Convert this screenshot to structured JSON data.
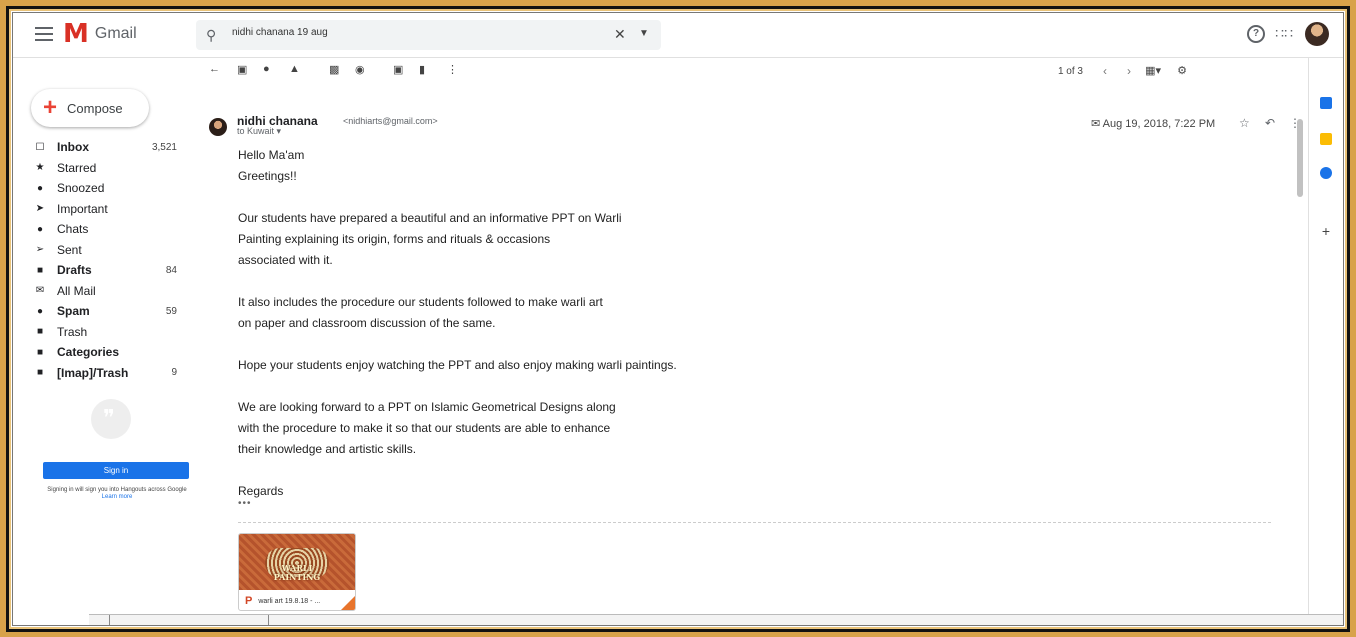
{
  "app": {
    "name": "Gmail"
  },
  "search": {
    "value": "nidhi chanana 19 aug"
  },
  "compose": {
    "label": "Compose"
  },
  "nav": [
    {
      "label": "Inbox",
      "count": "3,521",
      "icon": "inbox-icon",
      "glyph": "☐",
      "bold": true
    },
    {
      "label": "Starred",
      "count": "",
      "icon": "star-icon",
      "glyph": "★",
      "bold": false
    },
    {
      "label": "Snoozed",
      "count": "",
      "icon": "clock-icon",
      "glyph": "●",
      "bold": false
    },
    {
      "label": "Important",
      "count": "",
      "icon": "important-icon",
      "glyph": "➤",
      "bold": false
    },
    {
      "label": "Chats",
      "count": "",
      "icon": "chat-icon",
      "glyph": "●",
      "bold": false
    },
    {
      "label": "Sent",
      "count": "",
      "icon": "send-icon",
      "glyph": "➢",
      "bold": false
    },
    {
      "label": "Drafts",
      "count": "84",
      "icon": "draft-icon",
      "glyph": "■",
      "bold": true
    },
    {
      "label": "All Mail",
      "count": "",
      "icon": "all-mail-icon",
      "glyph": "✉",
      "bold": false
    },
    {
      "label": "Spam",
      "count": "59",
      "icon": "spam-icon",
      "glyph": "●",
      "bold": true
    },
    {
      "label": "Trash",
      "count": "",
      "icon": "trash-icon",
      "glyph": "■",
      "bold": false
    },
    {
      "label": "Categories",
      "count": "",
      "icon": "label-icon",
      "glyph": "■",
      "bold": true
    },
    {
      "label": "[Imap]/Trash",
      "count": "9",
      "icon": "label-icon",
      "glyph": "■",
      "bold": true
    }
  ],
  "hangouts": {
    "signin_label": "Sign in",
    "note": "Signing in will sign you into Hangouts across Google",
    "learn_more": "Learn more"
  },
  "pager": {
    "text": "1 of 3"
  },
  "message": {
    "sender_name": "nidhi chanana",
    "sender_email": "<nidhiarts@gmail.com>",
    "to": "to Kuwait ▾",
    "date": "Aug 19, 2018, 7:22 PM",
    "body": {
      "p1": "Hello Ma'am",
      "p2": "Greetings!!",
      "p3a": "Our students have prepared a beautiful and an informative PPT on Warli",
      "p3b": "Painting explaining its origin, forms and rituals & occasions",
      "p3c": "associated with it.",
      "p4a": "It also includes the procedure our students followed to make warli art",
      "p4b": "on paper and classroom discussion of the same.",
      "p5": "Hope your students enjoy watching the PPT and also enjoy making warli paintings.",
      "p6a": "We are looking forward to a PPT on Islamic Geometrical Designs along",
      "p6b": "with the procedure to make it so that our students are able to enhance",
      "p6c": "their knowledge and artistic skills.",
      "p7": "Regards"
    },
    "ellipsis": "•••"
  },
  "attachment": {
    "thumb_title": "WARLI PAINTING",
    "filename": "warli art 19.8.18 - ..."
  },
  "colors": {
    "gmail_red": "#d93025",
    "signin_blue": "#1a73e8",
    "frame_gold": "#d8a24a"
  }
}
